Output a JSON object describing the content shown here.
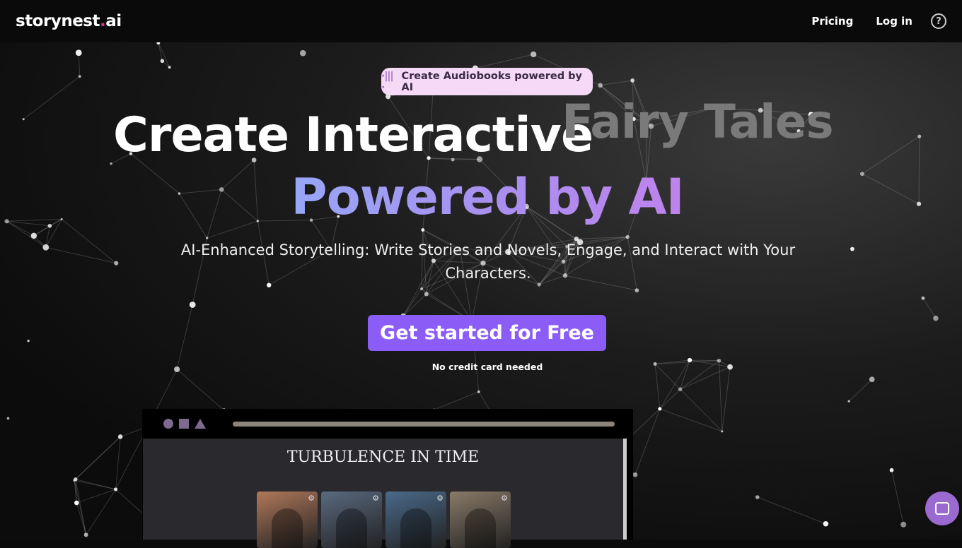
{
  "header": {
    "logo_main": "storynest",
    "logo_dot": ".",
    "logo_tld": "ai",
    "nav": [
      {
        "label": "Pricing"
      },
      {
        "label": "Log in"
      }
    ],
    "help_icon": "question-circle-icon"
  },
  "hero": {
    "badge": "Create Audiobooks powered by AI",
    "badge_icon": "sound-wave-icon",
    "title_static": "Create Interactive",
    "title_rotating": "Fairy Tales",
    "title_line2": "Powered by AI",
    "subtitle": "AI-Enhanced Storytelling: Write Stories and Novels, Engage, and Interact with Your Characters.",
    "cta": "Get started for Free",
    "note": "No credit card needed"
  },
  "preview": {
    "title": "TURBULENCE IN TIME",
    "cards": [
      {
        "bg": "#b0785a"
      },
      {
        "bg": "#5a6a80"
      },
      {
        "bg": "#4a6a8a"
      },
      {
        "bg": "#8a7a68"
      }
    ]
  },
  "colors": {
    "accent": "#8b5cf6",
    "badge_bg": "#f5d9f7",
    "logo_dot": "#d63384",
    "chat": "#9b6ad0"
  },
  "chat_icon": "chat-bubble-icon"
}
